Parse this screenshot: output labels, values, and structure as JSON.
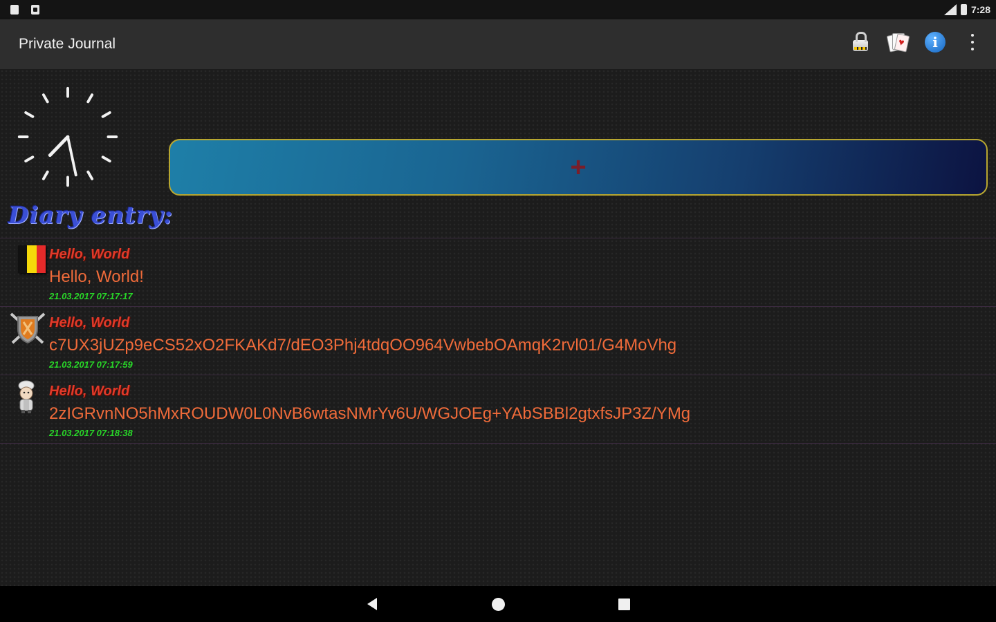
{
  "status_bar": {
    "time": "7:28",
    "icons": [
      "sd-card-icon",
      "screenshot-icon",
      "signal-icon",
      "battery-icon"
    ]
  },
  "app_bar": {
    "title": "Private Journal",
    "actions": [
      {
        "name": "lock-icon"
      },
      {
        "name": "cards-icon"
      },
      {
        "name": "info-icon",
        "glyph": "i"
      },
      {
        "name": "overflow-menu-icon"
      }
    ]
  },
  "clock": {
    "hour": 7,
    "minute": 28
  },
  "add_button": {
    "label": "+",
    "icon": "plus-icon",
    "border_color": "#b8a730",
    "plus_color": "#7a1e2a"
  },
  "diary_heading": "Diary entry:",
  "entries": [
    {
      "avatar": "belgium-flag-icon",
      "title": "Hello, World",
      "body": "Hello, World!",
      "date": "21.03.2017 07:17:17"
    },
    {
      "avatar": "shield-swords-icon",
      "title": "Hello, World",
      "body": "c7UX3jUZp9eCS52xO2FKAKd7/dEO3Phj4tdqOO964VwbebOAmqK2rvl01/G4MoVhg",
      "date": "21.03.2017 07:17:59"
    },
    {
      "avatar": "chef-character-icon",
      "title": "Hello, World",
      "body": "2zIGRvnNO5hMxROUDW0L0NvB6wtasNMrYv6U/WGJOEg+YAbSBBl2gtxfsJP3Z/YMg",
      "date": "21.03.2017 07:18:38"
    }
  ],
  "nav_bar": {
    "buttons": [
      "back-icon",
      "home-icon",
      "recents-icon"
    ]
  },
  "colors": {
    "entry_title": "#e03a2a",
    "entry_body": "#f06b3a",
    "entry_date": "#28d828",
    "heading": "#3a4fd6"
  }
}
